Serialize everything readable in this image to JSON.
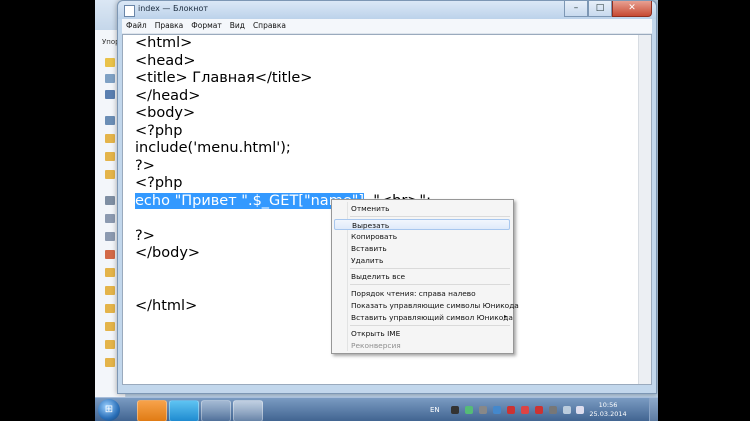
{
  "window": {
    "title": "index — Блокнот",
    "min_label": "–",
    "max_label": "□",
    "close_label": "✕"
  },
  "background": {
    "explorer_label": "Упор"
  },
  "menubar": {
    "items": [
      "Файл",
      "Правка",
      "Формат",
      "Вид",
      "Справка"
    ]
  },
  "editor": {
    "lines": [
      "<html>",
      "<head>",
      "<title> Главная</title>",
      "</head>",
      "<body>",
      "<?php",
      "include('menu.html');",
      "?>",
      "<?php"
    ],
    "line10_selected": "echo \"Привет \".$_GET[\"name\"]",
    "line10_rest": " .\"<br>\";",
    "lines_after": [
      "",
      "?>",
      "</body>",
      "",
      "",
      "</html>"
    ]
  },
  "context_menu": {
    "items": [
      {
        "label": "Отменить",
        "disabled": false
      },
      {
        "label": "Вырезать",
        "disabled": false
      },
      {
        "label": "Копировать",
        "disabled": false
      },
      {
        "label": "Вставить",
        "disabled": false
      },
      {
        "label": "Удалить",
        "disabled": false
      },
      {
        "label": "Выделить все",
        "disabled": false
      },
      {
        "label": "Порядок чтения: справа налево",
        "disabled": false
      },
      {
        "label": "Показать управляющие символы Юникода",
        "disabled": false
      },
      {
        "label": "Вставить управляющий символ Юникода",
        "disabled": false
      },
      {
        "label": "Открыть IME",
        "disabled": false
      },
      {
        "label": "Реконверсия",
        "disabled": true
      }
    ],
    "submenu_arrow": "▸"
  },
  "taskbar": {
    "start_label": "⊞",
    "language": "EN",
    "time": "10:56",
    "date": "25.03.2014"
  },
  "colors": {
    "selection": "#3399ff",
    "desktop": "#b9cfe4",
    "taskbar": "#4f73a0"
  }
}
